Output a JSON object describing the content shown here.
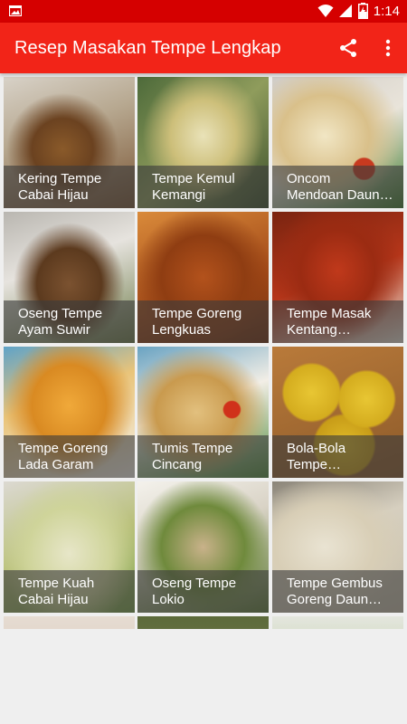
{
  "status_bar": {
    "time": "1:14"
  },
  "app_bar": {
    "title": "Resep Masakan Tempe Lengkap"
  },
  "icons": {
    "share": "share-icon",
    "more": "more-vert-icon"
  },
  "colors": {
    "status_bar": "#d50000",
    "app_bar": "#f22418",
    "background": "#efefef"
  },
  "recipes": [
    {
      "line1": "Kering Tempe",
      "line2": "Cabai Hijau"
    },
    {
      "line1": "Tempe Kemul",
      "line2": "Kemangi"
    },
    {
      "line1": "Oncom",
      "line2": "Mendoan Daun…"
    },
    {
      "line1": "Oseng Tempe",
      "line2": "Ayam Suwir"
    },
    {
      "line1": "Tempe Goreng",
      "line2": "Lengkuas"
    },
    {
      "line1": "Tempe Masak",
      "line2": "Kentang…"
    },
    {
      "line1": "Tempe Goreng",
      "line2": "Lada Garam"
    },
    {
      "line1": "Tumis Tempe",
      "line2": "Cincang"
    },
    {
      "line1": "Bola-Bola",
      "line2": "Tempe…"
    },
    {
      "line1": "Tempe Kuah",
      "line2": "Cabai Hijau"
    },
    {
      "line1": "Oseng Tempe",
      "line2": "Lokio"
    },
    {
      "line1": "Tempe Gembus",
      "line2": "Goreng Daun…"
    }
  ]
}
